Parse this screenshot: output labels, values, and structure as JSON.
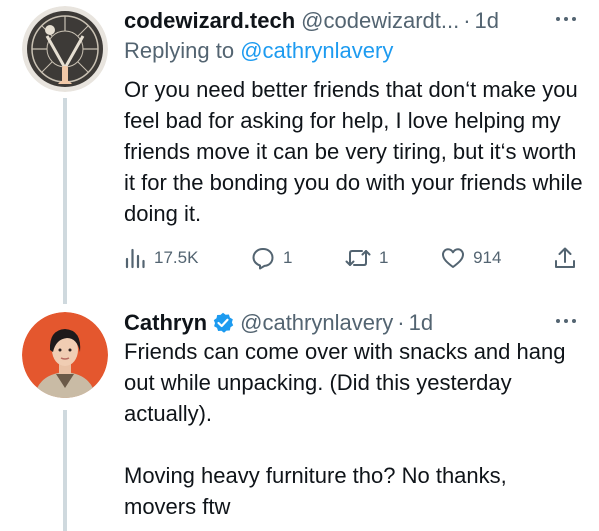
{
  "tweets": [
    {
      "name": "codewizard.tech",
      "handle": "@codewizardt...",
      "separator": "·",
      "time": "1d",
      "replying_prefix": "Replying to ",
      "replying_handle": "@cathrynlavery",
      "text": "Or you need better friends that don‘t make you feel bad for asking for help, I love helping my friends move it can be very tiring, but it‘s worth it for the bonding you do with your friends while doing it.",
      "stats": {
        "views": "17.5K",
        "replies": "1",
        "retweets": "1",
        "likes": "914"
      }
    },
    {
      "name": "Cathryn",
      "verified": true,
      "handle": "@cathrynlavery",
      "separator": "·",
      "time": "1d",
      "text": "Friends can come over with snacks and hang out while unpacking. (Did this yesterday actually).\n\nMoving heavy furniture tho? No thanks, movers ftw"
    }
  ],
  "icons": {
    "views": "views-chart-icon",
    "reply": "reply-bubble-icon",
    "retweet": "retweet-icon",
    "like": "heart-icon",
    "share": "share-upload-icon",
    "more": "more-dots-icon",
    "verified": "verified-badge-icon"
  },
  "colors": {
    "accent": "#1d9bf0",
    "muted": "#536471",
    "text": "#0f1419",
    "line": "#cfd9de"
  }
}
